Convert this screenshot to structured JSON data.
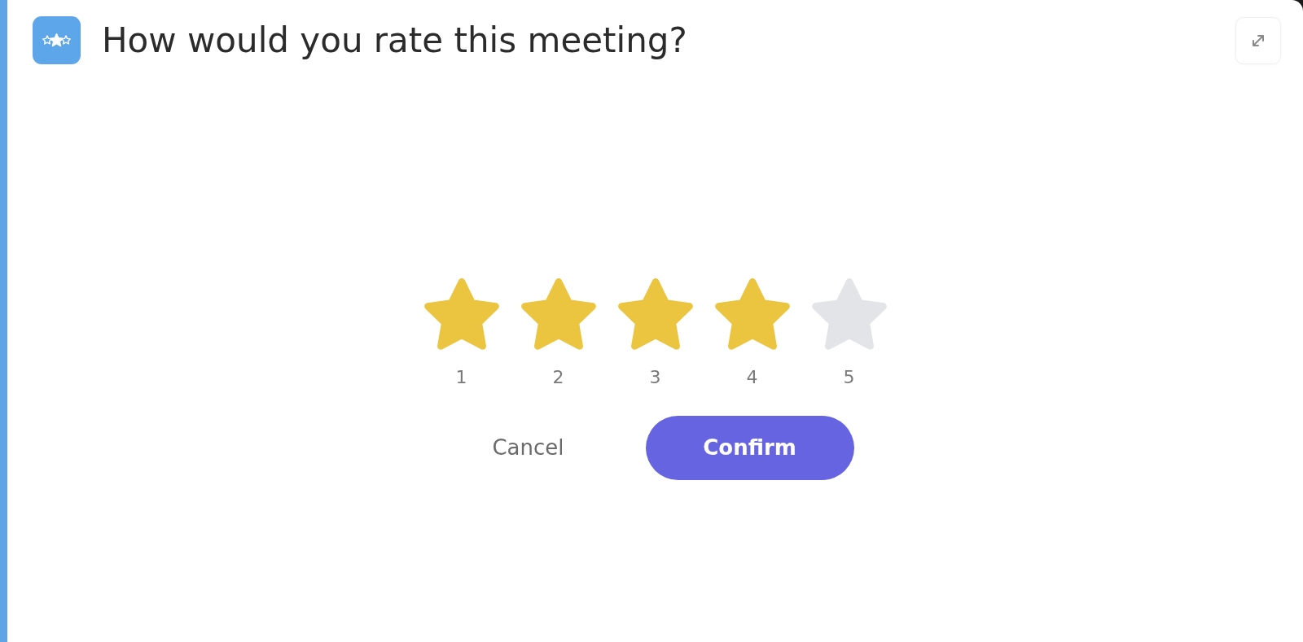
{
  "header": {
    "title": "How would you rate this meeting?"
  },
  "rating": {
    "stars": 4,
    "labels": [
      "1",
      "2",
      "3",
      "4",
      "5"
    ]
  },
  "buttons": [
    {
      "label": "Cancel",
      "kind": "text"
    },
    {
      "label": "Confirm",
      "kind": "primary"
    }
  ]
}
